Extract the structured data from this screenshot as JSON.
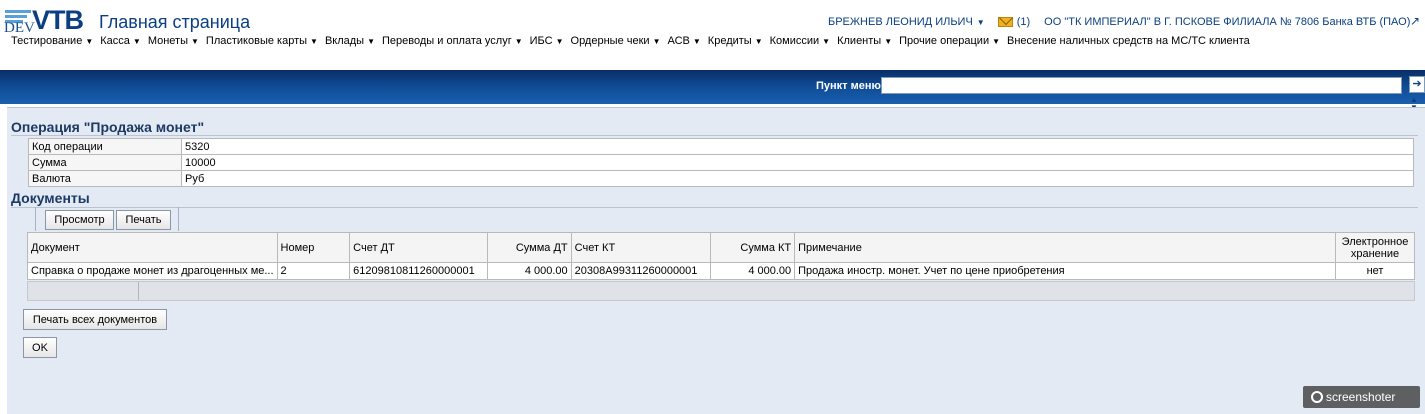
{
  "header": {
    "logo_dev": "DEV",
    "logo_vtb": "VTB",
    "title": "Главная страница",
    "user_name": "БРЕЖНЕВ ЛЕОНИД ИЛЬИЧ",
    "mail_count": "(1)",
    "org_name": "ОО \"ТК ИМПЕРИАЛ\" В Г. ПСКОВЕ ФИЛИАЛА № 7806 Банка ВТБ (ПАО)"
  },
  "menu": [
    {
      "label": "Тестирование",
      "has_dropdown": true
    },
    {
      "label": "Касса",
      "has_dropdown": true
    },
    {
      "label": "Монеты",
      "has_dropdown": true
    },
    {
      "label": "Пластиковые карты",
      "has_dropdown": true
    },
    {
      "label": "Вклады",
      "has_dropdown": true
    },
    {
      "label": "Переводы и оплата услуг",
      "has_dropdown": true
    },
    {
      "label": "ИБС",
      "has_dropdown": true
    },
    {
      "label": "Ордерные чеки",
      "has_dropdown": true
    },
    {
      "label": "АСВ",
      "has_dropdown": true
    },
    {
      "label": "Кредиты",
      "has_dropdown": true
    },
    {
      "label": "Комиссии",
      "has_dropdown": true
    },
    {
      "label": "Клиенты",
      "has_dropdown": true
    },
    {
      "label": "Прочие операции",
      "has_dropdown": true
    },
    {
      "label": "Внесение наличных средств на МС/ТС клиента",
      "has_dropdown": false
    }
  ],
  "menu_search": {
    "label": "Пункт меню",
    "value": ""
  },
  "operation": {
    "title": "Операция \"Продажа монет\"",
    "fields": [
      {
        "key": "Код операции",
        "value": "5320"
      },
      {
        "key": "Сумма",
        "value": "10000"
      },
      {
        "key": "Валюта",
        "value": "Руб"
      }
    ]
  },
  "documents": {
    "title": "Документы",
    "view_button": "Просмотр",
    "print_button": "Печать",
    "columns": [
      "Документ",
      "Номер",
      "Счет ДТ",
      "Сумма ДТ",
      "Счет КТ",
      "Сумма КТ",
      "Примечание",
      "Электронное хранение"
    ],
    "rows": [
      {
        "document": "Справка о продаже монет из драгоценных ме...",
        "number": "2",
        "account_dt": "61209810811260000001",
        "sum_dt": "4 000.00",
        "account_kt": "20308A99311260000001",
        "sum_kt": "4 000.00",
        "note": "Продажа иностр. монет. Учет по цене приобретения",
        "e_storage": "нет"
      }
    ]
  },
  "actions": {
    "print_all": "Печать всех документов",
    "ok": "OK"
  },
  "watermark": "screenshoter",
  "colors": {
    "brand_blue": "#0b3f82",
    "band_dark": "#0a2d66",
    "band_light": "#1a5fae",
    "panel_bg": "#e3eaf3"
  }
}
